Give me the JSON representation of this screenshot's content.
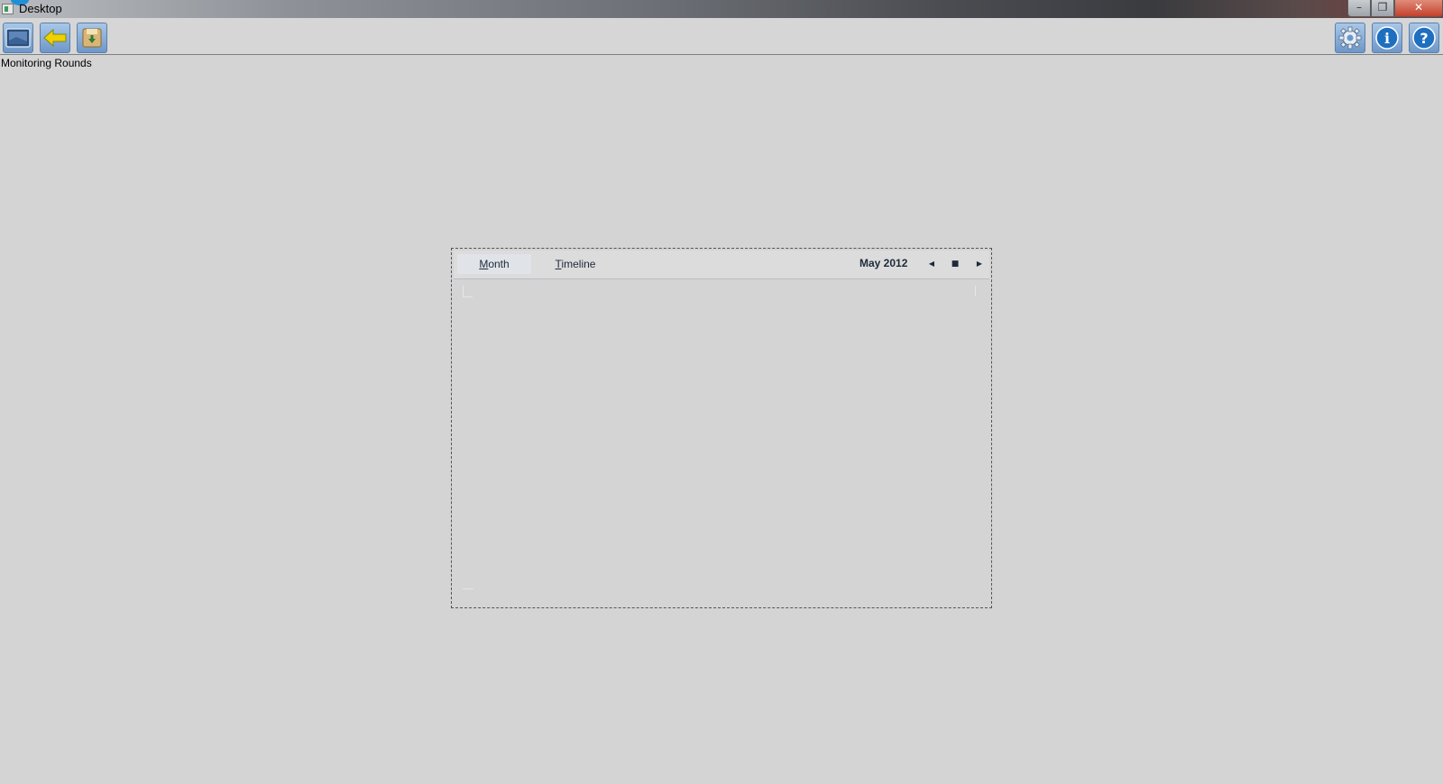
{
  "window": {
    "title": "Desktop",
    "controls": {
      "minimize": "–",
      "maximize": "❐",
      "close": "✕"
    }
  },
  "toolbar": {
    "left_buttons": [
      {
        "icon": "desktop-icon"
      },
      {
        "icon": "back-arrow-icon"
      },
      {
        "icon": "save-icon"
      }
    ],
    "right_buttons": [
      {
        "icon": "gear-icon"
      },
      {
        "icon": "info-icon",
        "glyph": "i"
      },
      {
        "icon": "help-icon",
        "glyph": "?"
      }
    ]
  },
  "page": {
    "label": "Monitoring Rounds"
  },
  "scheduler": {
    "tabs": [
      {
        "label_first": "M",
        "label_rest": "onth",
        "active": true
      },
      {
        "label_first": "T",
        "label_rest": "imeline",
        "active": false
      }
    ],
    "period": "May 2012",
    "nav": {
      "prev": "◀",
      "today": "■",
      "next": "▶"
    }
  },
  "colors": {
    "background": "#d4d4d4",
    "toolbar_button": "#6d97c9",
    "back_arrow": "#f0d000",
    "close_button": "#c2412b"
  }
}
